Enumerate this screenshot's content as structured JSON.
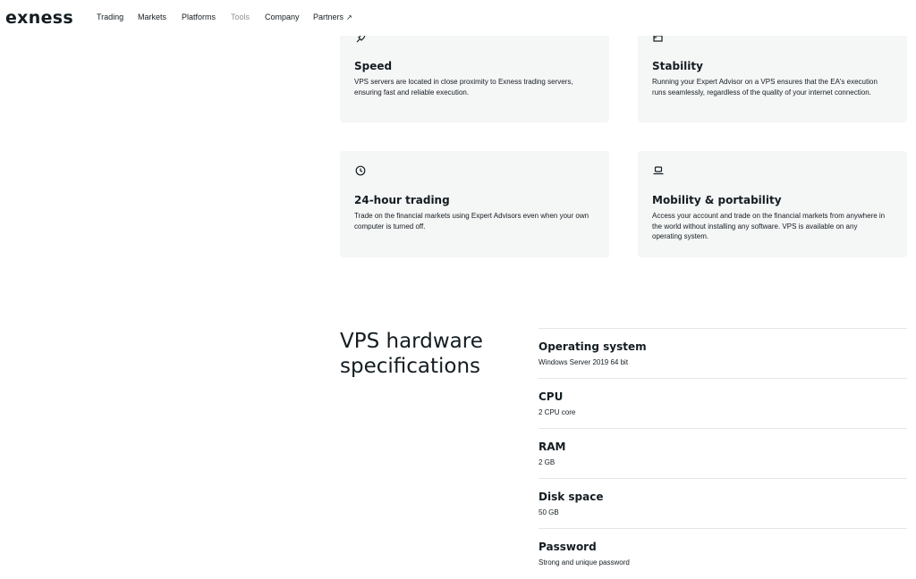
{
  "nav": {
    "logo": "exness",
    "items": [
      {
        "label": "Trading"
      },
      {
        "label": "Markets"
      },
      {
        "label": "Platforms"
      },
      {
        "label": "Tools"
      },
      {
        "label": "Company"
      },
      {
        "label": "Partners"
      }
    ],
    "active_item": "Tools",
    "partners_icon": "external-arrow-icon"
  },
  "features": [
    {
      "icon": "rocket-icon",
      "title": "Speed",
      "description": "VPS servers are located in close proximity to Exness trading servers, ensuring fast and reliable execution."
    },
    {
      "icon": "server-icon",
      "title": "Stability",
      "description": "Running your Expert Advisor on a VPS ensures that the EA's execution runs seamlessly, regardless of the quality of your internet connection."
    },
    {
      "icon": "clock-icon",
      "title": "24-hour trading",
      "description": "Trade on the financial markets using Expert Advisors even when your own computer is turned off."
    },
    {
      "icon": "laptop-icon",
      "title": "Mobility & portability",
      "description": "Access your account and trade on the financial markets from anywhere in the world without installing any software. VPS is available on any operating system."
    }
  ],
  "specs": {
    "heading": "VPS hardware specifications",
    "rows": [
      {
        "label": "Operating system",
        "value": "Windows Server 2019 64 bit"
      },
      {
        "label": "CPU",
        "value": "2 CPU core"
      },
      {
        "label": "RAM",
        "value": "2 GB"
      },
      {
        "label": "Disk space",
        "value": "50 GB"
      },
      {
        "label": "Password",
        "value": "Strong and unique password"
      }
    ]
  },
  "colors": {
    "text": "#141d22",
    "muted_nav": "#8c9296",
    "card_bg": "#f5f6f6",
    "divider": "#e4e6e7"
  }
}
